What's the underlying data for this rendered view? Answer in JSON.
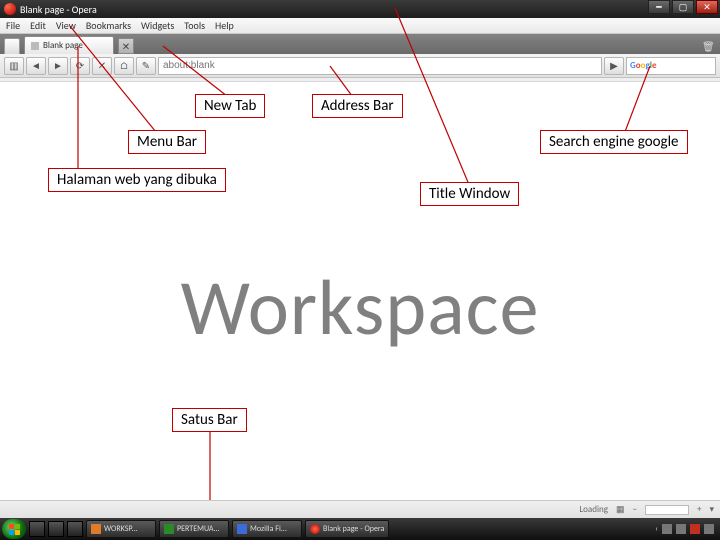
{
  "titlebar": {
    "title": "Blank page - Opera"
  },
  "menubar": {
    "items": [
      "File",
      "Edit",
      "View",
      "Bookmarks",
      "Widgets",
      "Tools",
      "Help"
    ]
  },
  "tabbar": {
    "active_tab_label": "Blank page",
    "new_tab_glyph": "✕"
  },
  "addrbar": {
    "placeholder": "about:blank",
    "search_label": "Google"
  },
  "callouts": {
    "new_tab": "New Tab",
    "address_bar": "Address Bar",
    "menu_bar": "Menu Bar",
    "search": "Search engine google",
    "opened_page": "Halaman web yang dibuka",
    "title_window": "Title Window",
    "status_bar": "Satus Bar"
  },
  "workspace_label": "Workspace",
  "statusbar": {
    "loading_label": "Loading"
  },
  "taskbar": {
    "buttons": [
      {
        "label": "WORKSP..."
      },
      {
        "label": "PERTEMUA..."
      },
      {
        "label": "Mozilla Fi..."
      },
      {
        "label": "Blank page - Opera"
      }
    ]
  }
}
